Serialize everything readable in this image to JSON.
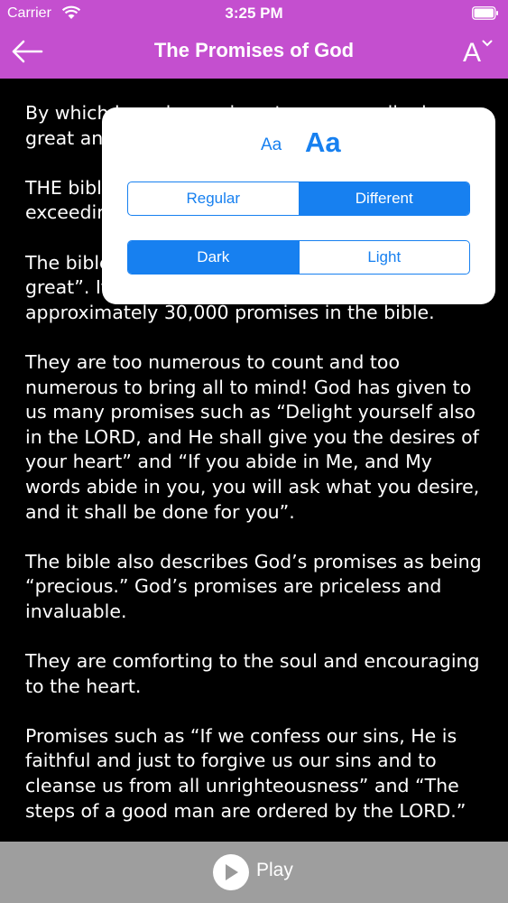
{
  "status": {
    "carrier": "Carrier",
    "time": "3:25 PM"
  },
  "nav": {
    "title": "The Promises of God",
    "font_button_label": "A"
  },
  "content": {
    "paragraphs": [
      "By which have been given to us exceedingly great and precious promises.",
      " THE bible describes God's promises as being exceedingly great.",
      "The bible says God's promises are “exceedingly great”. It has been estimated that there are approximately 30,000 promises in the bible.",
      "They are too numerous to count and too numerous to bring all to mind! God has given to us many promises such as “Delight yourself also in the LORD, and He shall give you the desires of your heart”  and “If you abide in Me, and My words abide in you, you will ask what you desire, and it shall be done for you”.",
      "The bible also describes God’s promises as being “precious.” God’s promises are priceless and invaluable.",
      "They are comforting to the soul and encouraging to the heart.",
      "Promises such as “If we confess our sins, He is faithful and just to forgive us our sins and to cleanse us from all unrighteousness” and “The steps of a good man are ordered by the LORD.”"
    ]
  },
  "popover": {
    "size_small": "Aa",
    "size_large": "Aa",
    "font_options": [
      "Regular",
      "Different"
    ],
    "font_selected": "Different",
    "theme_options": [
      "Dark",
      "Light"
    ],
    "theme_selected": "Dark"
  },
  "player": {
    "play_label": "Play"
  },
  "colors": {
    "header": "#c44fcf",
    "accent": "#1780f0",
    "background": "#000000"
  }
}
